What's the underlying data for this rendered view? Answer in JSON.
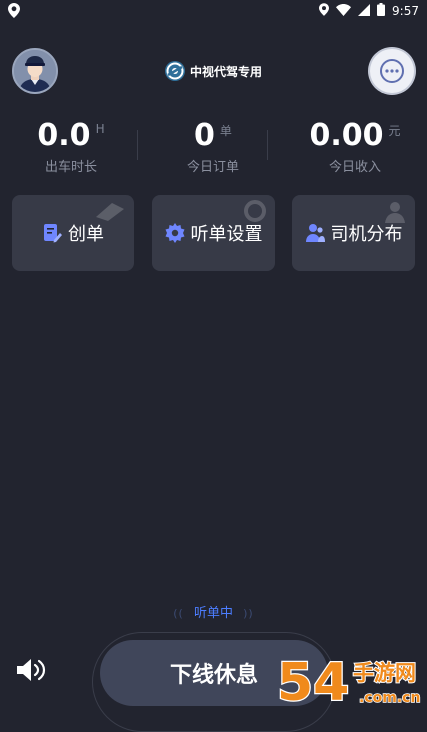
{
  "status_bar": {
    "time": "9:57",
    "icons": [
      "location-icon",
      "wifi-icon",
      "signal-icon",
      "battery-icon"
    ]
  },
  "header": {
    "app_title": "中视代驾专用",
    "avatar_icon": "driver-avatar",
    "chat_icon": "chat-bubble-icon"
  },
  "stats": [
    {
      "value": "0.0",
      "unit": "H",
      "label": "出车时长"
    },
    {
      "value": "0",
      "unit": "单",
      "label": "今日订单"
    },
    {
      "value": "0.00",
      "unit": "元",
      "label": "今日收入"
    }
  ],
  "actions": [
    {
      "label": "创单",
      "icon": "edit-document-icon"
    },
    {
      "label": "听单设置",
      "icon": "gear-icon"
    },
    {
      "label": "司机分布",
      "icon": "driver-people-icon"
    }
  ],
  "listening_status": {
    "left_marks": "((",
    "text": "听单中",
    "right_marks": "))"
  },
  "bottom": {
    "offline_button_label": "下线休息",
    "sound_icon": "speaker-icon"
  },
  "watermark": {
    "brand_number": "54",
    "brand_text": "手游网",
    "domain": ".com.cn"
  },
  "colors": {
    "background": "#22242f",
    "card": "#373a47",
    "accent_blue": "#4c7dff",
    "icon_blue": "#6f86ff",
    "watermark_orange": "#f08a1c"
  }
}
